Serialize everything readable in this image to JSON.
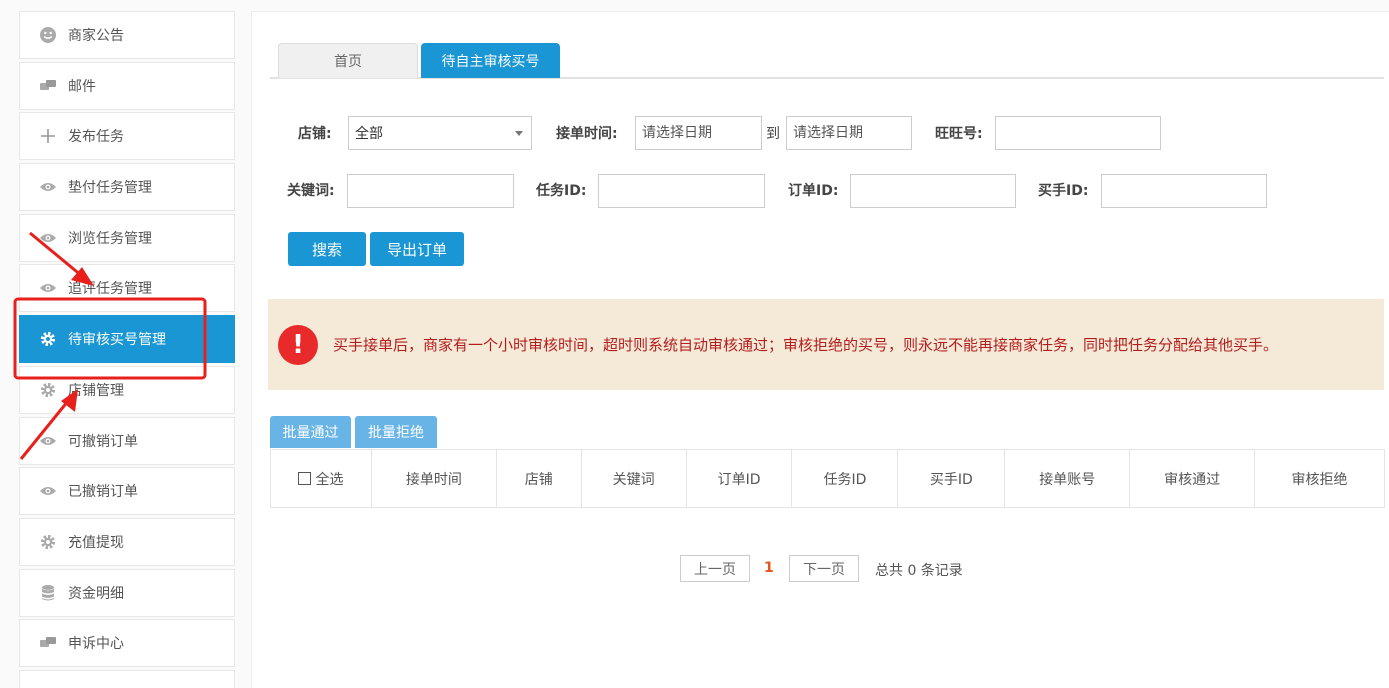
{
  "sidebar": {
    "items": [
      {
        "label": "商家公告",
        "icon": "smile-icon"
      },
      {
        "label": "邮件",
        "icon": "chat-icon"
      },
      {
        "label": "发布任务",
        "icon": "plus-icon"
      },
      {
        "label": "垫付任务管理",
        "icon": "eye-icon"
      },
      {
        "label": "浏览任务管理",
        "icon": "eye-icon"
      },
      {
        "label": "追评任务管理",
        "icon": "eye-icon"
      },
      {
        "label": "待审核买号管理",
        "icon": "gear-icon"
      },
      {
        "label": "店铺管理",
        "icon": "gear-icon"
      },
      {
        "label": "可撤销订单",
        "icon": "eye-icon"
      },
      {
        "label": "已撤销订单",
        "icon": "eye-icon"
      },
      {
        "label": "充值提现",
        "icon": "gear-icon"
      },
      {
        "label": "资金明细",
        "icon": "database-icon"
      },
      {
        "label": "申诉中心",
        "icon": "chat-icon"
      }
    ]
  },
  "tabs": {
    "home": "首页",
    "current": "待自主审核买号"
  },
  "filters": {
    "shop_label": "店铺:",
    "shop_value": "全部",
    "time_label": "接单时间:",
    "date_placeholder": "请选择日期",
    "to": "到",
    "wangwang_label": "旺旺号:",
    "keyword_label": "关键词:",
    "task_id_label": "任务ID:",
    "order_id_label": "订单ID:",
    "buyer_id_label": "买手ID:"
  },
  "actions": {
    "search": "搜索",
    "export": "导出订单",
    "batch_pass": "批量通过",
    "batch_reject": "批量拒绝"
  },
  "notice": {
    "icon": "!",
    "text": "买手接单后，商家有一个小时审核时间，超时则系统自动审核通过；审核拒绝的买号，则永远不能再接商家任务，同时把任务分配给其他买手。"
  },
  "table": {
    "select_all": "全选",
    "headers": [
      "接单时间",
      "店铺",
      "关键词",
      "订单ID",
      "任务ID",
      "买手ID",
      "接单账号",
      "审核通过",
      "审核拒绝"
    ]
  },
  "pagination": {
    "prev": "上一页",
    "current": "1",
    "next": "下一页",
    "total": "总共 0 条记录"
  },
  "colors": {
    "primary": "#1a96d4",
    "warning_bg": "#f5ead8",
    "warning_text": "#b21d1d",
    "annotation": "#e8201c"
  }
}
